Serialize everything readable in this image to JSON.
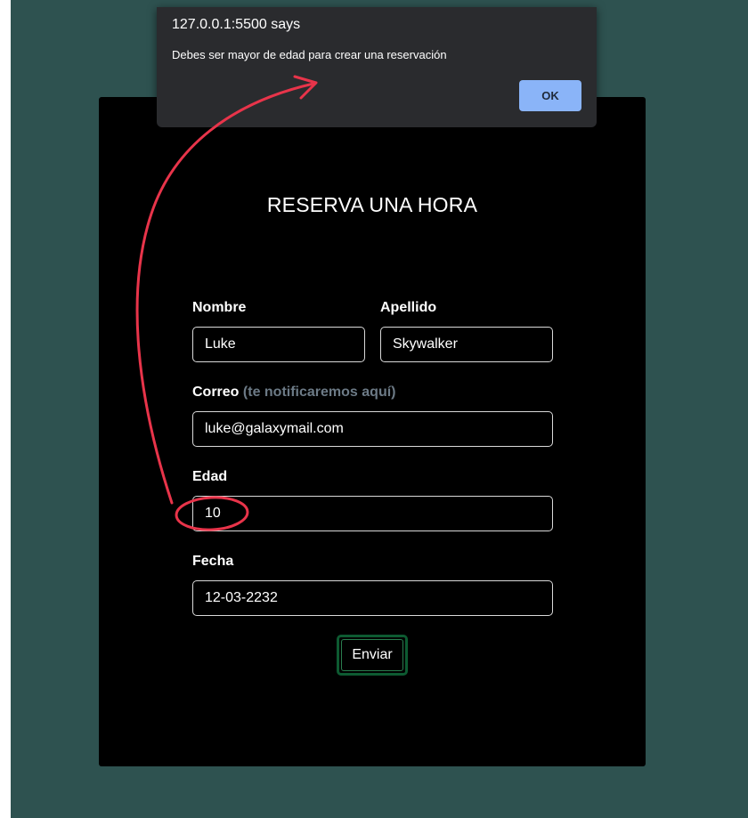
{
  "dialog": {
    "origin": "127.0.0.1:5500 says",
    "message": "Debes ser mayor de edad para crear una reservación",
    "ok_label": "OK"
  },
  "form": {
    "title": "RESERVA UNA HORA",
    "nombre": {
      "label": "Nombre",
      "value": "Luke"
    },
    "apellido": {
      "label": "Apellido",
      "value": "Skywalker"
    },
    "correo": {
      "label": "Correo",
      "hint": "(te notificaremos aquí)",
      "value": "luke@galaxymail.com"
    },
    "edad": {
      "label": "Edad",
      "value": "10"
    },
    "fecha": {
      "label": "Fecha",
      "value": "12-03-2232"
    },
    "submit_label": "Enviar"
  },
  "colors": {
    "page_background": "#2e5250",
    "card_background": "#000000",
    "dialog_background": "#2a2b2e",
    "dialog_button": "#8ab4f8",
    "submit_border": "#0d5a31",
    "annotation": "#e8344a",
    "hint_text": "#6c7a86"
  },
  "icons": {
    "annotation_arrow": "curved-arrow-icon",
    "annotation_circle": "highlight-ellipse-icon"
  }
}
